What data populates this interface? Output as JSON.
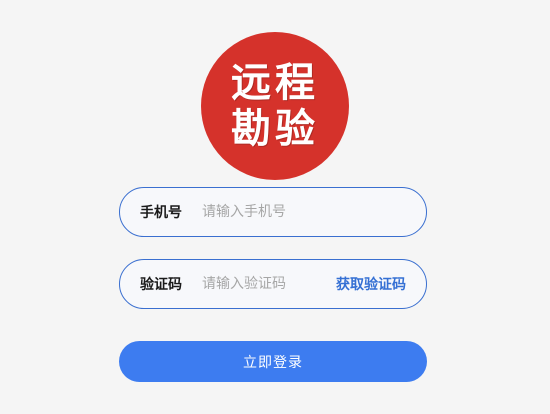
{
  "logo": {
    "line1": "远程",
    "line2": "勘验",
    "color": "#d5322b"
  },
  "phone_field": {
    "label": "手机号",
    "placeholder": "请输入手机号",
    "value": ""
  },
  "code_field": {
    "label": "验证码",
    "placeholder": "请输入验证码",
    "value": "",
    "get_code_label": "获取验证码"
  },
  "login_button": {
    "label": "立即登录",
    "color": "#3d7cf0"
  },
  "colors": {
    "field_border": "#3a6fd0",
    "link": "#3570d4",
    "background": "#f5f5f5"
  }
}
